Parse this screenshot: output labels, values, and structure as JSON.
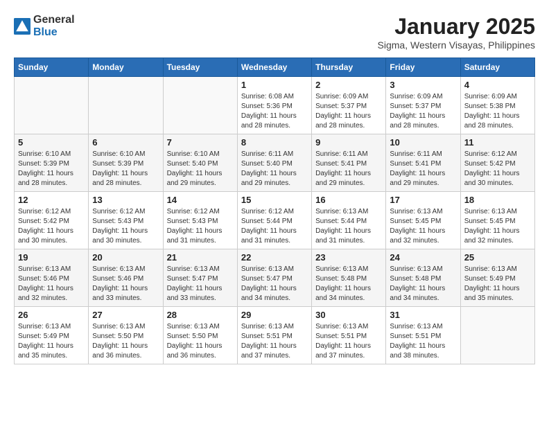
{
  "logo": {
    "general": "General",
    "blue": "Blue"
  },
  "title": "January 2025",
  "subtitle": "Sigma, Western Visayas, Philippines",
  "weekdays": [
    "Sunday",
    "Monday",
    "Tuesday",
    "Wednesday",
    "Thursday",
    "Friday",
    "Saturday"
  ],
  "weeks": [
    [
      {
        "num": "",
        "info": ""
      },
      {
        "num": "",
        "info": ""
      },
      {
        "num": "",
        "info": ""
      },
      {
        "num": "1",
        "info": "Sunrise: 6:08 AM\nSunset: 5:36 PM\nDaylight: 11 hours and 28 minutes."
      },
      {
        "num": "2",
        "info": "Sunrise: 6:09 AM\nSunset: 5:37 PM\nDaylight: 11 hours and 28 minutes."
      },
      {
        "num": "3",
        "info": "Sunrise: 6:09 AM\nSunset: 5:37 PM\nDaylight: 11 hours and 28 minutes."
      },
      {
        "num": "4",
        "info": "Sunrise: 6:09 AM\nSunset: 5:38 PM\nDaylight: 11 hours and 28 minutes."
      }
    ],
    [
      {
        "num": "5",
        "info": "Sunrise: 6:10 AM\nSunset: 5:39 PM\nDaylight: 11 hours and 28 minutes."
      },
      {
        "num": "6",
        "info": "Sunrise: 6:10 AM\nSunset: 5:39 PM\nDaylight: 11 hours and 28 minutes."
      },
      {
        "num": "7",
        "info": "Sunrise: 6:10 AM\nSunset: 5:40 PM\nDaylight: 11 hours and 29 minutes."
      },
      {
        "num": "8",
        "info": "Sunrise: 6:11 AM\nSunset: 5:40 PM\nDaylight: 11 hours and 29 minutes."
      },
      {
        "num": "9",
        "info": "Sunrise: 6:11 AM\nSunset: 5:41 PM\nDaylight: 11 hours and 29 minutes."
      },
      {
        "num": "10",
        "info": "Sunrise: 6:11 AM\nSunset: 5:41 PM\nDaylight: 11 hours and 29 minutes."
      },
      {
        "num": "11",
        "info": "Sunrise: 6:12 AM\nSunset: 5:42 PM\nDaylight: 11 hours and 30 minutes."
      }
    ],
    [
      {
        "num": "12",
        "info": "Sunrise: 6:12 AM\nSunset: 5:42 PM\nDaylight: 11 hours and 30 minutes."
      },
      {
        "num": "13",
        "info": "Sunrise: 6:12 AM\nSunset: 5:43 PM\nDaylight: 11 hours and 30 minutes."
      },
      {
        "num": "14",
        "info": "Sunrise: 6:12 AM\nSunset: 5:43 PM\nDaylight: 11 hours and 31 minutes."
      },
      {
        "num": "15",
        "info": "Sunrise: 6:12 AM\nSunset: 5:44 PM\nDaylight: 11 hours and 31 minutes."
      },
      {
        "num": "16",
        "info": "Sunrise: 6:13 AM\nSunset: 5:44 PM\nDaylight: 11 hours and 31 minutes."
      },
      {
        "num": "17",
        "info": "Sunrise: 6:13 AM\nSunset: 5:45 PM\nDaylight: 11 hours and 32 minutes."
      },
      {
        "num": "18",
        "info": "Sunrise: 6:13 AM\nSunset: 5:45 PM\nDaylight: 11 hours and 32 minutes."
      }
    ],
    [
      {
        "num": "19",
        "info": "Sunrise: 6:13 AM\nSunset: 5:46 PM\nDaylight: 11 hours and 32 minutes."
      },
      {
        "num": "20",
        "info": "Sunrise: 6:13 AM\nSunset: 5:46 PM\nDaylight: 11 hours and 33 minutes."
      },
      {
        "num": "21",
        "info": "Sunrise: 6:13 AM\nSunset: 5:47 PM\nDaylight: 11 hours and 33 minutes."
      },
      {
        "num": "22",
        "info": "Sunrise: 6:13 AM\nSunset: 5:47 PM\nDaylight: 11 hours and 34 minutes."
      },
      {
        "num": "23",
        "info": "Sunrise: 6:13 AM\nSunset: 5:48 PM\nDaylight: 11 hours and 34 minutes."
      },
      {
        "num": "24",
        "info": "Sunrise: 6:13 AM\nSunset: 5:48 PM\nDaylight: 11 hours and 34 minutes."
      },
      {
        "num": "25",
        "info": "Sunrise: 6:13 AM\nSunset: 5:49 PM\nDaylight: 11 hours and 35 minutes."
      }
    ],
    [
      {
        "num": "26",
        "info": "Sunrise: 6:13 AM\nSunset: 5:49 PM\nDaylight: 11 hours and 35 minutes."
      },
      {
        "num": "27",
        "info": "Sunrise: 6:13 AM\nSunset: 5:50 PM\nDaylight: 11 hours and 36 minutes."
      },
      {
        "num": "28",
        "info": "Sunrise: 6:13 AM\nSunset: 5:50 PM\nDaylight: 11 hours and 36 minutes."
      },
      {
        "num": "29",
        "info": "Sunrise: 6:13 AM\nSunset: 5:51 PM\nDaylight: 11 hours and 37 minutes."
      },
      {
        "num": "30",
        "info": "Sunrise: 6:13 AM\nSunset: 5:51 PM\nDaylight: 11 hours and 37 minutes."
      },
      {
        "num": "31",
        "info": "Sunrise: 6:13 AM\nSunset: 5:51 PM\nDaylight: 11 hours and 38 minutes."
      },
      {
        "num": "",
        "info": ""
      }
    ]
  ]
}
